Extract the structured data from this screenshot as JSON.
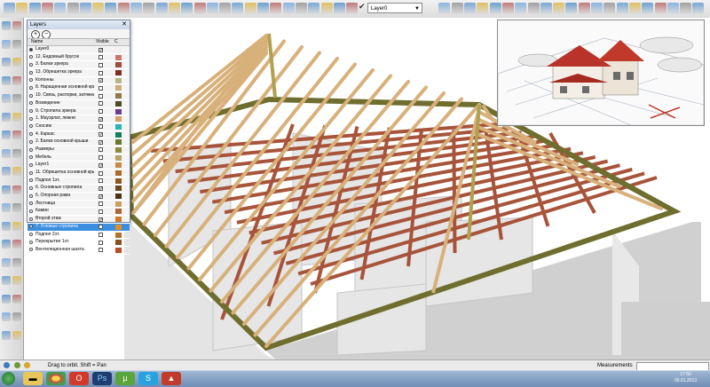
{
  "toolbar": {
    "active_layer": "Layer0",
    "icons": [
      "new-icon",
      "open-icon",
      "save-icon",
      "cut-icon",
      "copy-icon",
      "paste-icon",
      "erase-icon",
      "undo-icon",
      "redo-icon",
      "print-icon",
      "select-icon",
      "make-component-icon",
      "paint-icon",
      "eraser-icon",
      "rectangle-icon",
      "line-icon",
      "circle-icon",
      "arc-icon",
      "polygon-icon",
      "freehand-icon",
      "move-icon",
      "push-pull-icon",
      "rotate-icon",
      "follow-me-icon",
      "scale-icon",
      "offset-icon",
      "tape-icon",
      "dimension-icon",
      "protractor-icon",
      "text-icon",
      "axes-icon",
      "3d-text-icon",
      "orbit-icon",
      "pan-icon",
      "zoom-icon",
      "zoom-window-icon",
      "zoom-extents-icon",
      "previous-view-icon",
      "next-view-icon",
      "position-camera-icon",
      "walk-icon",
      "look-around-icon",
      "section-plane-icon",
      "iso-view-icon",
      "top-view-icon",
      "front-view-icon",
      "right-view-icon",
      "back-view-icon",
      "left-view-icon",
      "xray-icon",
      "wireframe-icon",
      "hidden-line-icon",
      "shaded-icon",
      "shaded-textures-icon",
      "monochrome-icon"
    ]
  },
  "layers_panel": {
    "title": "Layers",
    "col_name": "Name",
    "col_visible": "Visible",
    "col_color": "C",
    "layers": [
      {
        "name": "Layer0",
        "active": true,
        "visible": true,
        "color": "#f2f2f2"
      },
      {
        "name": "12. Ендовный брусок",
        "active": false,
        "visible": false,
        "color": "#c97a6a"
      },
      {
        "name": "3. Балки эркера",
        "active": false,
        "visible": false,
        "color": "#a34a3c"
      },
      {
        "name": "13. Обрешетка эркера",
        "active": false,
        "visible": false,
        "color": "#7d3126"
      },
      {
        "name": "Колонны",
        "active": false,
        "visible": true,
        "color": "#b8b58a"
      },
      {
        "name": "8. Наращенная основной крыш",
        "active": false,
        "visible": false,
        "color": "#c9b07a"
      },
      {
        "name": "10. Связь, распорки, затяжки",
        "active": false,
        "visible": false,
        "color": "#8f7a46"
      },
      {
        "name": "Возведение",
        "active": false,
        "visible": false,
        "color": "#4f4a26"
      },
      {
        "name": "9. Стропила эркера",
        "active": false,
        "visible": false,
        "color": "#6e3b8e"
      },
      {
        "name": "1. Мауэрлат, лежни",
        "active": false,
        "visible": true,
        "color": "#d7a06a"
      },
      {
        "name": "Сносим",
        "active": false,
        "visible": false,
        "color": "#2bb3b3"
      },
      {
        "name": "4. Каркас",
        "active": false,
        "visible": true,
        "color": "#137e5c"
      },
      {
        "name": "2. Балки основной крыши",
        "active": false,
        "visible": true,
        "color": "#6b7a2a"
      },
      {
        "name": "Размеры",
        "active": false,
        "visible": false,
        "color": "#8a8a3a"
      },
      {
        "name": "Мебель",
        "active": false,
        "visible": false,
        "color": "#b9a16a"
      },
      {
        "name": "Layer1",
        "active": false,
        "visible": true,
        "color": "#c68a4a"
      },
      {
        "name": "11. Обрешетка основной крыш",
        "active": false,
        "visible": false,
        "color": "#a86b2a"
      },
      {
        "name": "Подпол 1эт.",
        "active": false,
        "visible": false,
        "color": "#8b5a22"
      },
      {
        "name": "6. Основные стропила",
        "active": false,
        "visible": true,
        "color": "#6b4a1c"
      },
      {
        "name": "5. Опорная рама",
        "active": false,
        "visible": true,
        "color": "#4a331a"
      },
      {
        "name": "Лестница",
        "active": false,
        "visible": false,
        "color": "#caa15a"
      },
      {
        "name": "Камин",
        "active": false,
        "visible": false,
        "color": "#b0643a"
      },
      {
        "name": "Второй этаж",
        "active": false,
        "visible": true,
        "color": "#d27a2a"
      },
      {
        "name": "7. Угловые стропила",
        "active": false,
        "visible": true,
        "color": "#e0902a",
        "selected": true
      },
      {
        "name": "Подпол 2эт.",
        "active": false,
        "visible": false,
        "color": "#b5702a"
      },
      {
        "name": "Перекрытие 1эт.",
        "active": false,
        "visible": false,
        "color": "#8a4f1e"
      },
      {
        "name": "Вентиляционная шахта",
        "active": false,
        "visible": false,
        "color": "#c04a22"
      }
    ]
  },
  "status": {
    "hint": "Drag to orbit.  Shift = Pan",
    "measurements_label": "Measurements",
    "measurements_value": ""
  },
  "taskbar": {
    "apps": [
      "start-orb-icon",
      "explorer-icon",
      "chrome-icon",
      "opera-icon",
      "photoshop-icon",
      "utorrent-icon",
      "skype-icon",
      "sketchup-icon"
    ],
    "clock_time": "17:50",
    "clock_date": "06.01.2013"
  }
}
